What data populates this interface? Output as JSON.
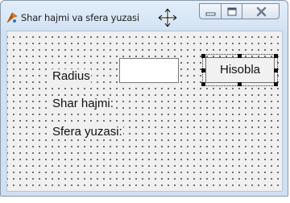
{
  "window": {
    "title": "Shar hajmi va sfera yuzasi"
  },
  "form": {
    "radius_label": "Radius",
    "radius_value": "",
    "volume_label": "Shar hajmi:",
    "surface_label": "Sfera yuzasi:",
    "calculate_button": "Hisobla"
  },
  "icons": {
    "app": "delphi-app-icon",
    "minimize": "minimize-icon",
    "maximize": "maximize-icon",
    "close": "close-icon",
    "cursor": "resize-cursor-icon"
  }
}
